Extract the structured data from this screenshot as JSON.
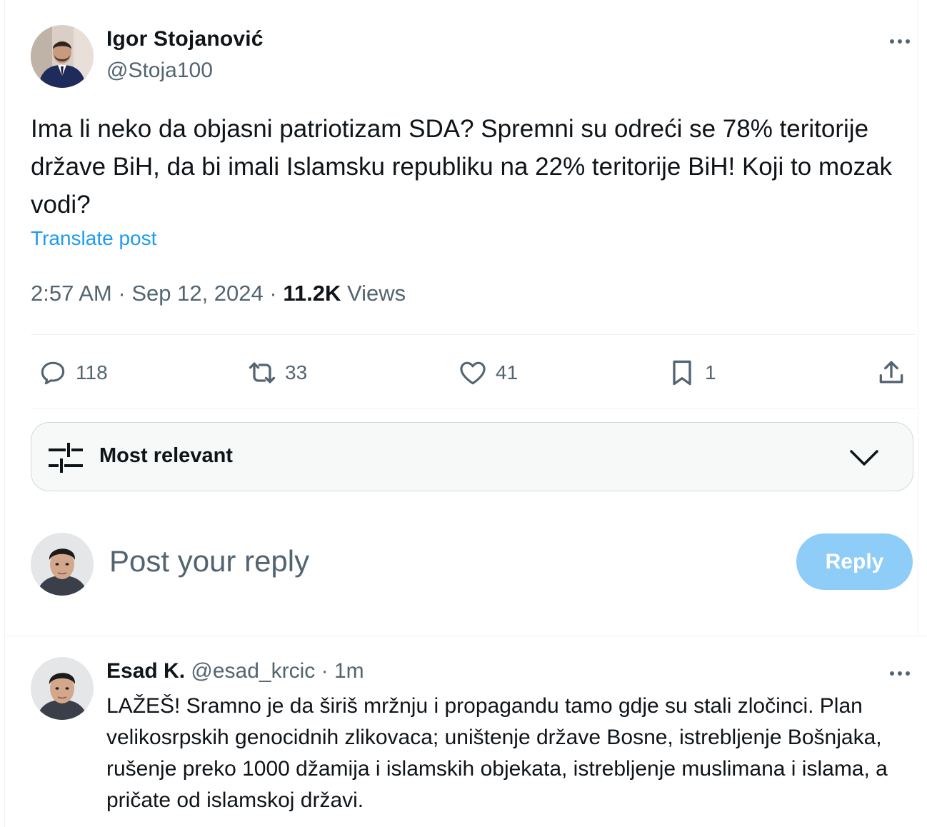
{
  "post": {
    "author_name": "Igor Stojanović",
    "author_handle": "@Stoja100",
    "text": "Ima li neko da objasni patriotizam SDA? Spremni su odreći se 78% teritorije države BiH, da bi imali Islamsku republiku na 22% teritorije BiH! Koji to mozak vodi?",
    "translate_label": "Translate post",
    "time": "2:57 AM",
    "date": "Sep 12, 2024",
    "separator": "·",
    "views_count": "11.2K",
    "views_label": "Views",
    "more_icon": "ellipsis-icon"
  },
  "actions": {
    "replies": "118",
    "reposts": "33",
    "likes": "41",
    "bookmarks": "1",
    "icons": [
      "reply-icon",
      "repost-icon",
      "like-icon",
      "bookmark-icon",
      "share-icon"
    ]
  },
  "sort": {
    "label": "Most relevant",
    "icon": "filter-sliders-icon",
    "chevron": "chevron-down-icon"
  },
  "composer": {
    "placeholder": "Post your reply",
    "button_label": "Reply",
    "button_color": "#8ecdf7"
  },
  "reply": {
    "author_name": "Esad K.",
    "author_handle": "@esad_krcic",
    "separator": "·",
    "time": "1m",
    "text": "LAŽEŠ! Sramno je da širiš mržnju i propagandu tamo gdje su stali zločinci. Plan velikosrpskih genocidnih zlikovaca; uništenje države Bosne, istrebljenje Bošnjaka, rušenje preko 1000 džamija i islamskih objekata, istrebljenje muslimana i islama, a pričate od islamskoj državi."
  },
  "colors": {
    "accent": "#1d9bf0",
    "text_primary": "#0f1419",
    "text_secondary": "#536471",
    "border": "#eff3f4"
  }
}
